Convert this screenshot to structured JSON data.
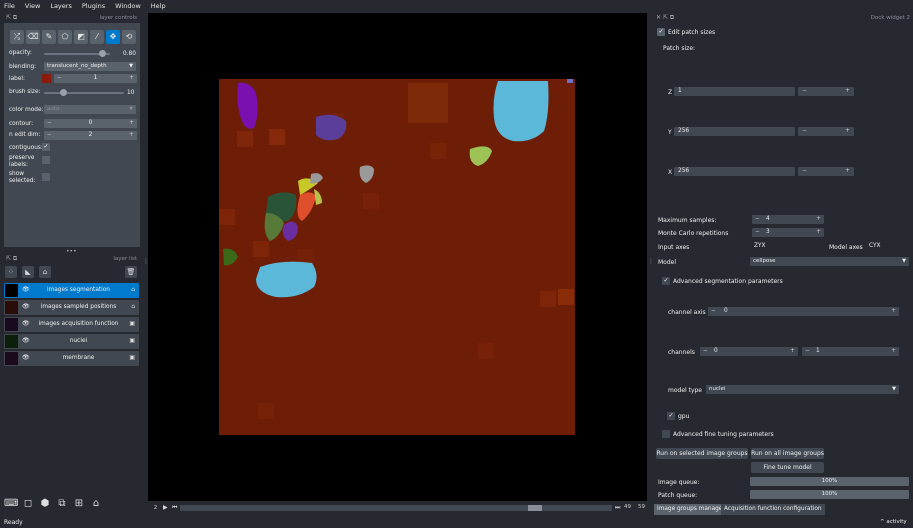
{
  "menubar": {
    "items": [
      "File",
      "View",
      "Layers",
      "Plugins",
      "Window",
      "Help"
    ]
  },
  "layer_controls": {
    "title": "layer controls",
    "opacity_label": "opacity:",
    "opacity_value": "0.80",
    "blending_label": "blending:",
    "blending_value": "translucent_no_depth",
    "label_label": "label:",
    "label_value": "1",
    "brush_size_label": "brush size:",
    "brush_size_value": "10",
    "color_mode_label": "color mode:",
    "color_mode_value": "auto",
    "contour_label": "contour:",
    "contour_value": "0",
    "n_edit_dim_label": "n edit dim:",
    "n_edit_dim_value": "2",
    "contiguous_label": "contiguous:",
    "preserve_labels_label": "preserve labels:",
    "show_selected_label": "show selected:"
  },
  "layer_list": {
    "title": "layer list",
    "layers": [
      {
        "name": "images segmentation"
      },
      {
        "name": "images sampled positions"
      },
      {
        "name": "images acquisition function"
      },
      {
        "name": "nuclei"
      },
      {
        "name": "membrane"
      }
    ]
  },
  "status": {
    "text": "Ready",
    "activity": "activity"
  },
  "dims": {
    "frame_value": "49",
    "frame_total": "59"
  },
  "dock": {
    "title": "Dock widget 2",
    "edit_patch_sizes": "Edit patch sizes",
    "patch_size_label": "Patch size:",
    "z_label": "Z",
    "z_value": "1",
    "y_label": "Y",
    "y_value": "256",
    "x_label": "X",
    "x_value": "256",
    "max_samples_label": "Maximum samples:",
    "max_samples_value": "4",
    "mc_label": "Monte Carlo repetitions",
    "mc_value": "3",
    "input_axes_label": "Input axes",
    "input_axes_value": "ZYX",
    "model_axes_label": "Model axes",
    "model_axes_value": "CYX",
    "model_label": "Model",
    "model_value": "cellpose",
    "adv_seg_label": "Advanced segmentation parameters",
    "channel_axis_label": "channel axis",
    "channel_axis_value": "0",
    "channels_label": "channels",
    "channels_value_1": "0",
    "channels_value_2": "1",
    "model_type_label": "model type",
    "model_type_value": "nuclei",
    "gpu_label": "gpu",
    "adv_ft_label": "Advanced fine tuning parameters",
    "run_selected": "Run on selected image groups",
    "run_all": "Run on all image groups",
    "fine_tune": "Fine tune model",
    "image_queue_label": "Image queue:",
    "image_queue_value": "100%",
    "patch_queue_label": "Patch queue:",
    "patch_queue_value": "100%",
    "tabs": [
      "Image groups manager",
      "Acquisition function configuration"
    ]
  },
  "colors": {
    "accent": "#007acc",
    "background": "#262930",
    "panel": "#414851"
  }
}
